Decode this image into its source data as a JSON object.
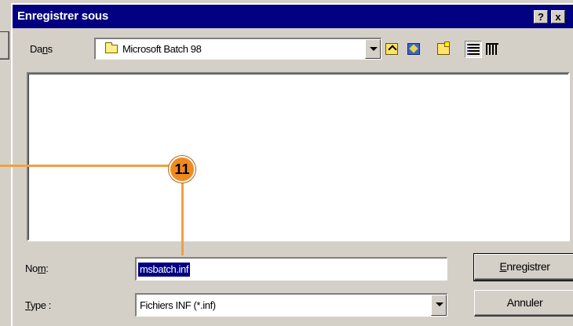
{
  "dialog": {
    "title": "Enregistrer sous",
    "help_glyph": "?",
    "close_glyph": "x"
  },
  "look_in": {
    "label_prefix": "Da",
    "label_accel": "n",
    "label_suffix": "s",
    "value": "Microsoft Batch 98",
    "icon": "folder-icon"
  },
  "toolbar": {
    "icons": [
      "up-one-level-icon",
      "desktop-icon",
      "new-folder-icon",
      "list-view-icon",
      "details-view-icon"
    ]
  },
  "file_name": {
    "label_prefix": "No",
    "label_accel": "m",
    "label_suffix": ":",
    "value": "msbatch.inf"
  },
  "file_type": {
    "label_accel": "T",
    "label_suffix": "ype :",
    "value": "Fichiers INF (*.inf)"
  },
  "buttons": {
    "save_accel": "E",
    "save_rest": "nregistrer",
    "cancel": "Annuler"
  },
  "annotation": {
    "number": "11",
    "color": "#f08a1e"
  },
  "colors": {
    "titlebar": "#000080",
    "selection": "#000080",
    "face": "#d4d0c8"
  }
}
